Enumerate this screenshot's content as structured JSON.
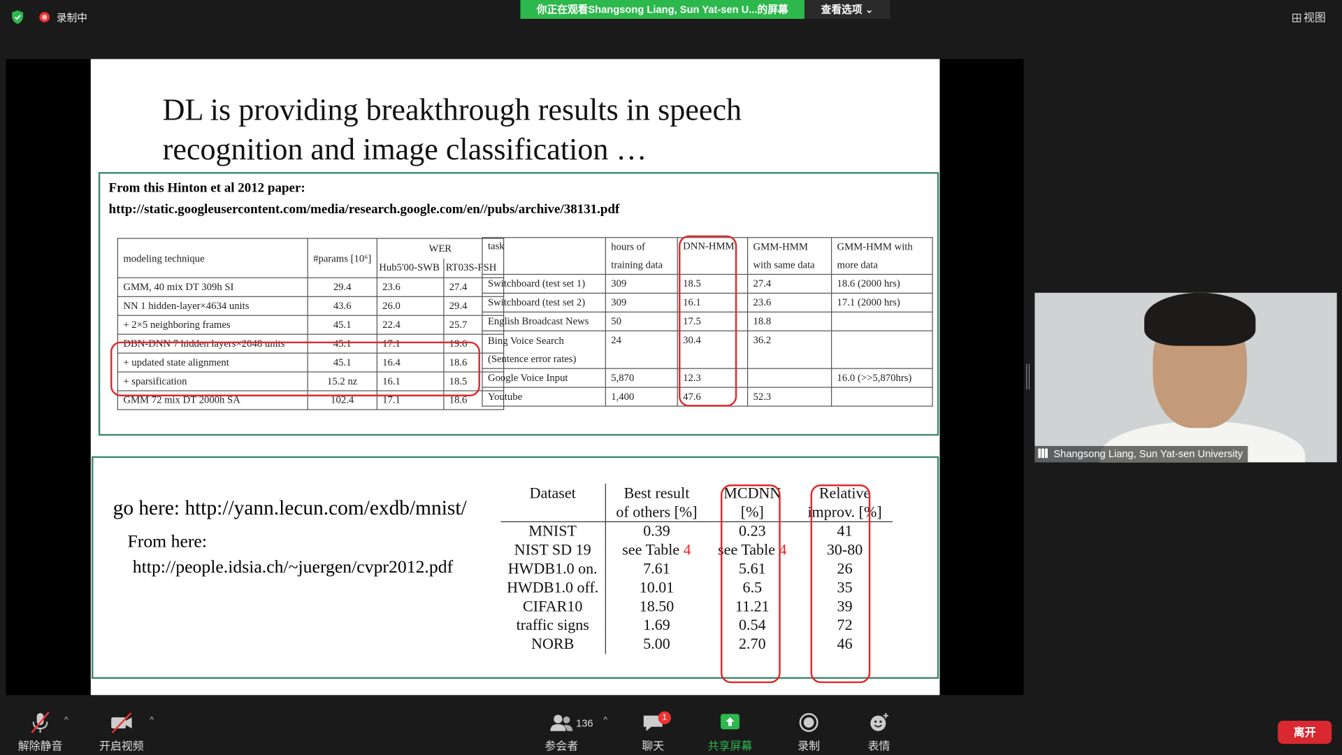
{
  "top": {
    "recording": "录制中",
    "viewing": "你正在观看Shangsong Liang, Sun Yat-sen U...的屏幕",
    "view_options": "查看选项 ⌄",
    "view": "视图"
  },
  "slide": {
    "title1": "DL is providing breakthrough results in speech",
    "title2": "recognition and image classification …",
    "src_line1": "From this Hinton et al 2012 paper:",
    "src_line2": "http://static.googleusercontent.com/media/research.google.com/en//pubs/archive/38131.pdf",
    "left_table": {
      "headers": [
        "modeling technique",
        "#params [10⁶]",
        "WER",
        "Hub5'00-SWB",
        "RT03S-FSH"
      ],
      "rows": [
        [
          "GMM, 40 mix DT 309h SI",
          "29.4",
          "23.6",
          "27.4"
        ],
        [
          "NN 1 hidden-layer×4634 units",
          "43.6",
          "26.0",
          "29.4"
        ],
        [
          "+ 2×5 neighboring frames",
          "45.1",
          "22.4",
          "25.7"
        ],
        [
          "DBN-DNN 7 hidden layers×2048 units",
          "45.1",
          "17.1",
          "19.6"
        ],
        [
          "+ updated state alignment",
          "45.1",
          "16.4",
          "18.6"
        ],
        [
          "+ sparsification",
          "15.2 nz",
          "16.1",
          "18.5"
        ],
        [
          "GMM 72 mix DT 2000h SA",
          "102.4",
          "17.1",
          "18.6"
        ]
      ]
    },
    "right_table": {
      "headers": [
        "task",
        "hours of training data",
        "DNN-HMM",
        "GMM-HMM with same data",
        "GMM-HMM with more data"
      ],
      "rows": [
        [
          "Switchboard (test set 1)",
          "309",
          "18.5",
          "27.4",
          "18.6 (2000 hrs)"
        ],
        [
          "Switchboard (test set 2)",
          "309",
          "16.1",
          "23.6",
          "17.1 (2000 hrs)"
        ],
        [
          "English Broadcast News",
          "50",
          "17.5",
          "18.8",
          ""
        ],
        [
          "Bing Voice Search (Sentence error rates)",
          "24",
          "30.4",
          "36.2",
          ""
        ],
        [
          "Google Voice Input",
          "5,870",
          "12.3",
          "",
          "16.0 (>>5,870hrs)"
        ],
        [
          "Youtube",
          "1,400",
          "47.6",
          "52.3",
          ""
        ]
      ]
    },
    "go_here": "go here:  http://yann.lecun.com/exdb/mnist/",
    "from_here": "From here:",
    "url2": "http://people.idsia.ch/~juergen/cvpr2012.pdf",
    "mnist_table": {
      "h_dataset": "Dataset",
      "h_best1": "Best result",
      "h_best2": "of others [%]",
      "h_mc1": "MCDNN",
      "h_mc2": "[%]",
      "h_rel1": "Relative",
      "h_rel2": "improv. [%]",
      "rows": [
        [
          "MNIST",
          "0.39",
          "0.23",
          "41"
        ],
        [
          "NIST SD 19",
          "see Table",
          "see Table",
          "30-80"
        ],
        [
          "HWDB1.0 on.",
          "7.61",
          "5.61",
          "26"
        ],
        [
          "HWDB1.0 off.",
          "10.01",
          "6.5",
          "35"
        ],
        [
          "CIFAR10",
          "18.50",
          "11.21",
          "39"
        ],
        [
          "traffic signs",
          "1.69",
          "0.54",
          "72"
        ],
        [
          "NORB",
          "5.00",
          "2.70",
          "46"
        ]
      ],
      "table_ref": "4"
    }
  },
  "video": {
    "name": "Shangsong Liang, Sun Yat-sen University"
  },
  "toolbar": {
    "unmute": "解除静音",
    "start_video": "开启视频",
    "participants": "参会者",
    "participant_count": "136",
    "chat": "聊天",
    "chat_badge": "1",
    "share": "共享屏幕",
    "record": "录制",
    "reactions": "表情",
    "leave": "离开"
  }
}
